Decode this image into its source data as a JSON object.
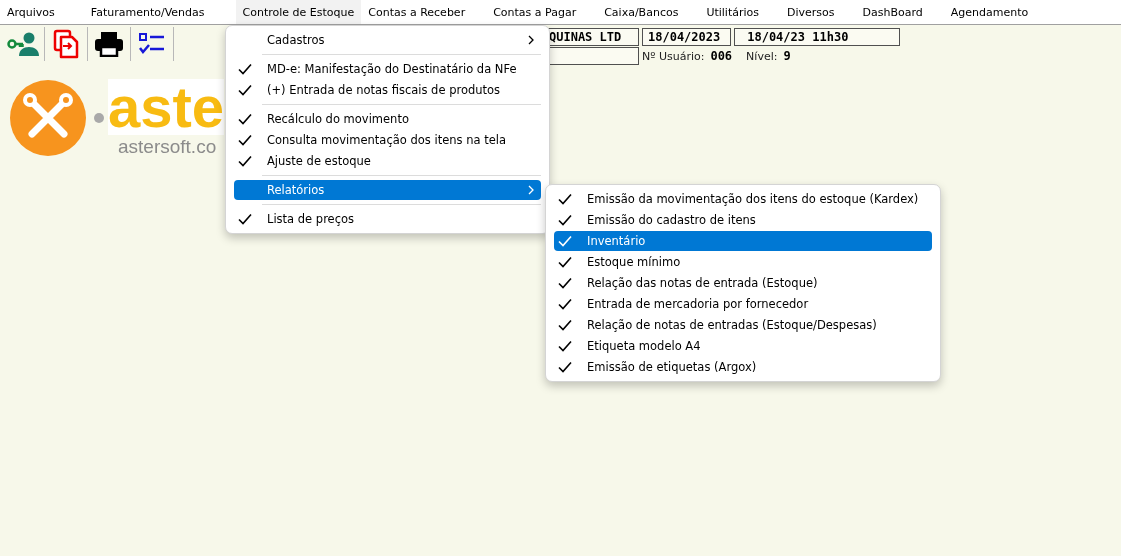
{
  "menubar": [
    {
      "label": "Arquivos",
      "selected": false
    },
    {
      "label": "Faturamento/Vendas",
      "selected": false
    },
    {
      "label": "Controle de Estoque",
      "selected": true
    },
    {
      "label": "Contas a Receber",
      "selected": false
    },
    {
      "label": "Contas a Pagar",
      "selected": false
    },
    {
      "label": "Caixa/Bancos",
      "selected": false
    },
    {
      "label": "Utilitários",
      "selected": false
    },
    {
      "label": "Diversos",
      "selected": false
    },
    {
      "label": "DashBoard",
      "selected": false
    },
    {
      "label": "Agendamento",
      "selected": false
    }
  ],
  "toolbar": [
    {
      "kind": "user-key"
    },
    {
      "kind": "copy"
    },
    {
      "kind": "printer"
    },
    {
      "kind": "checklist"
    }
  ],
  "logo": {
    "wordmark": "aste",
    "site": "astersoft.co"
  },
  "info": {
    "company": "QUINAS LTD",
    "date": "18/04/2023",
    "datetime": "18/04/23 11h30",
    "user_label": "Nº Usuário:",
    "user_value": "006",
    "level_label": "Nível:",
    "level_value": "9"
  },
  "menu": [
    {
      "kind": "item",
      "label": "Cadastros",
      "checked": false,
      "selected": false,
      "submenu": true
    },
    {
      "kind": "separator"
    },
    {
      "kind": "item",
      "label": "MD-e: Manifestação do Destinatário da NFe",
      "checked": true,
      "selected": false,
      "submenu": false
    },
    {
      "kind": "item",
      "label": "(+) Entrada de notas fiscais de produtos",
      "checked": true,
      "selected": false,
      "submenu": false
    },
    {
      "kind": "separator"
    },
    {
      "kind": "item",
      "label": "Recálculo do movimento",
      "checked": true,
      "selected": false,
      "submenu": false
    },
    {
      "kind": "item",
      "label": "Consulta movimentação dos itens na tela",
      "checked": true,
      "selected": false,
      "submenu": false
    },
    {
      "kind": "item",
      "label": "Ajuste de estoque",
      "checked": true,
      "selected": false,
      "submenu": false
    },
    {
      "kind": "separator"
    },
    {
      "kind": "item",
      "label": "Relatórios",
      "checked": false,
      "selected": true,
      "submenu": true
    },
    {
      "kind": "separator"
    },
    {
      "kind": "item",
      "label": "Lista de preços",
      "checked": true,
      "selected": false,
      "submenu": false
    }
  ],
  "submenu": [
    {
      "kind": "item",
      "label": "Emissão da movimentação dos itens do estoque (Kardex)",
      "checked": true,
      "selected": false,
      "submenu": false
    },
    {
      "kind": "item",
      "label": "Emissão do cadastro de itens",
      "checked": true,
      "selected": false,
      "submenu": false
    },
    {
      "kind": "item",
      "label": "Inventário",
      "checked": true,
      "selected": true,
      "submenu": false
    },
    {
      "kind": "item",
      "label": "Estoque mínimo",
      "checked": true,
      "selected": false,
      "submenu": false
    },
    {
      "kind": "item",
      "label": "Relação das notas de entrada (Estoque)",
      "checked": true,
      "selected": false,
      "submenu": false
    },
    {
      "kind": "item",
      "label": "Entrada de mercadoria por fornecedor",
      "checked": true,
      "selected": false,
      "submenu": false
    },
    {
      "kind": "item",
      "label": "Relação de notas de entradas (Estoque/Despesas)",
      "checked": true,
      "selected": false,
      "submenu": false
    },
    {
      "kind": "item",
      "label": "Etiqueta modelo A4",
      "checked": true,
      "selected": false,
      "submenu": false
    },
    {
      "kind": "item",
      "label": "Emissão de etiquetas (Argox)",
      "checked": true,
      "selected": false,
      "submenu": false
    }
  ]
}
